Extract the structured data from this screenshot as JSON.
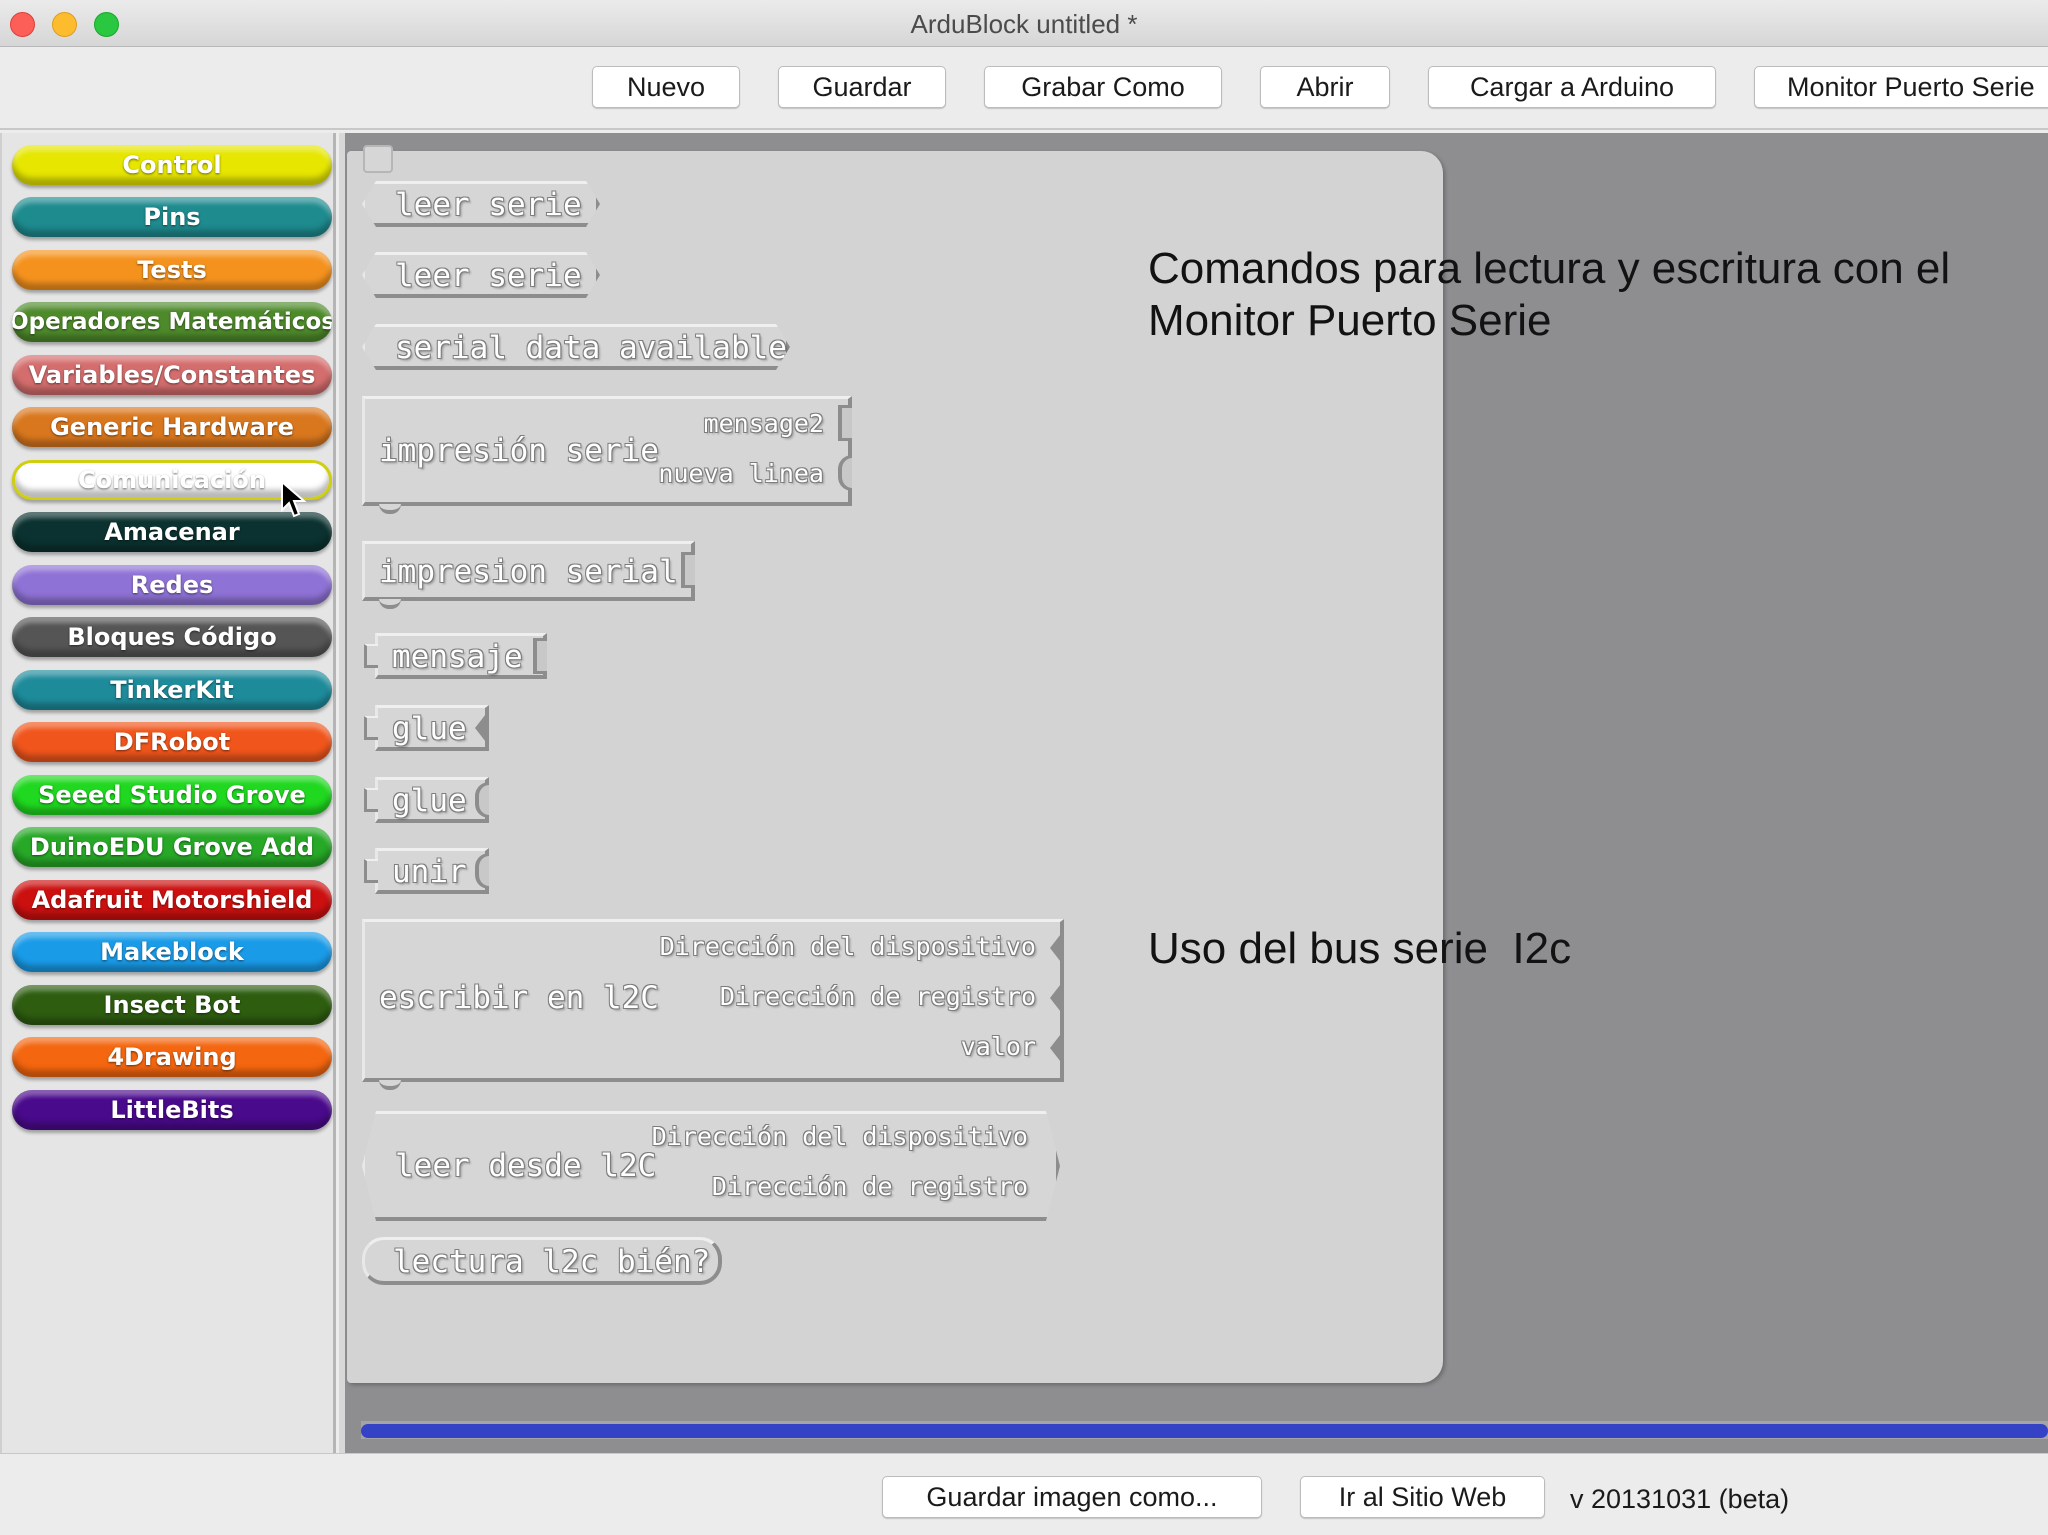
{
  "window": {
    "title": "ArduBlock untitled *"
  },
  "toolbar": {
    "buttons": [
      "Nuevo",
      "Guardar",
      "Grabar Como",
      "Abrir",
      "Cargar a Arduino",
      "Monitor Puerto Serie"
    ]
  },
  "sidebar": {
    "selected": "Comunicación",
    "categories": [
      {
        "label": "Control",
        "color": "#e6e600"
      },
      {
        "label": "Pins",
        "color": "#1e8b8f"
      },
      {
        "label": "Tests",
        "color": "#f5921e"
      },
      {
        "label": "Operadores Matemáticos",
        "color": "#4e8a2b"
      },
      {
        "label": "Variables/Constantes",
        "color": "#d46d6d"
      },
      {
        "label": "Generic Hardware",
        "color": "#d9771e"
      },
      {
        "label": "Comunicación",
        "color": "#ffffff"
      },
      {
        "label": "Amacenar",
        "color": "#0b3230"
      },
      {
        "label": "Redes",
        "color": "#8f72d6"
      },
      {
        "label": "Bloques Código",
        "color": "#555555"
      },
      {
        "label": "TinkerKit",
        "color": "#1e8b9b"
      },
      {
        "label": "DFRobot",
        "color": "#f0561c"
      },
      {
        "label": "Seeed Studio Grove",
        "color": "#1fd81f"
      },
      {
        "label": "DuinoEDU Grove Add",
        "color": "#27a827"
      },
      {
        "label": "Adafruit Motorshield",
        "color": "#cc1010"
      },
      {
        "label": "Makeblock",
        "color": "#1a9be8"
      },
      {
        "label": "Insect Bot",
        "color": "#2e5d10"
      },
      {
        "label": "4Drawing",
        "color": "#f4660f"
      },
      {
        "label": "LittleBits",
        "color": "#4a0a8c"
      }
    ]
  },
  "blocks": {
    "leer_serie_1": "leer serie",
    "leer_serie_2": "leer serie",
    "serial_data_available": "serial data available",
    "impresion_serie": {
      "label": "impresión serie",
      "sockets": [
        "mensage2",
        "nueva linea"
      ]
    },
    "impresion_serial": "impresion serial",
    "mensaje": "mensaje",
    "glue_1": "glue",
    "glue_2": "glue",
    "unir": "unir",
    "escribir_i2c": {
      "label": "escribir en l2C",
      "sockets": [
        "Dirección del dispositivo",
        "Dirección de registro",
        "valor"
      ]
    },
    "leer_i2c": {
      "label": "leer desde l2C",
      "sockets": [
        "Dirección del dispositivo",
        "Dirección de registro"
      ]
    },
    "lectura_i2c": "lectura l2c bién?"
  },
  "notes": {
    "serial": "Comandos para lectura y escritura con el Monitor Puerto Serie",
    "i2c": "Uso del bus serie  I2c"
  },
  "bottom": {
    "save_image": "Guardar imagen como...",
    "website": "Ir al Sitio Web",
    "version": "v 20131031 (beta)"
  },
  "colors": {
    "scrollbar": "#3443c6",
    "workspace": "#8e8e91"
  }
}
